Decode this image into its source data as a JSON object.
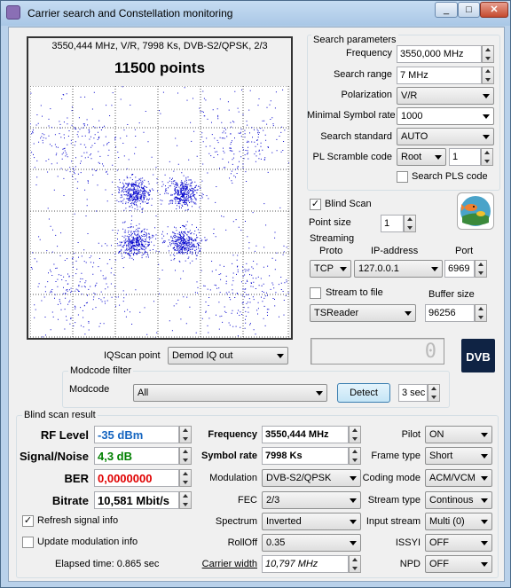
{
  "window": {
    "title": "Carrier search and Constellation monitoring"
  },
  "constellation": {
    "info": "3550,444 MHz, V/R, 7998 Ks, DVB-S2/QPSK, 2/3",
    "points_label": "11500 points"
  },
  "search_params": {
    "legend": "Search parameters",
    "frequency_label": "Frequency",
    "frequency_value": "3550,000 MHz",
    "range_label": "Search range",
    "range_value": "7 MHz",
    "polarization_label": "Polarization",
    "polarization_value": "V/R",
    "msr_label": "Minimal Symbol rate",
    "msr_value": "1000",
    "standard_label": "Search standard",
    "standard_value": "AUTO",
    "pls_label": "PL Scramble code",
    "pls_mode": "Root",
    "pls_value": "1",
    "search_pls_label": "Search PLS code"
  },
  "blind": {
    "blind_scan_label": "Blind Scan",
    "point_size_label": "Point size",
    "point_size_value": "1"
  },
  "streaming": {
    "legend": "Streaming",
    "proto_label": "Proto",
    "proto_value": "TCP",
    "ip_label": "IP-address",
    "ip_value": "127.0.0.1",
    "port_label": "Port",
    "port_value": "6969",
    "stream_file_label": "Stream to file",
    "buffer_label": "Buffer size",
    "reader_value": "TSReader",
    "buffer_value": "96256"
  },
  "iq": {
    "label": "IQScan point",
    "value": "Demod IQ out",
    "counter": "0"
  },
  "modcode": {
    "legend": "Modcode filter",
    "label": "Modcode",
    "value": "All",
    "detect_label": "Detect",
    "interval_value": "3 sec"
  },
  "result": {
    "legend": "Blind scan result",
    "rf_label": "RF Level",
    "rf_value": "-35 dBm",
    "sn_label": "Signal/Noise",
    "sn_value": "4,3 dB",
    "ber_label": "BER",
    "ber_value": "0,0000000",
    "bitrate_label": "Bitrate",
    "bitrate_value": "10,581 Mbit/s",
    "freq_label": "Frequency",
    "freq_value": "3550,444 MHz",
    "sr_label": "Symbol rate",
    "sr_value": "7998 Ks",
    "mod_label": "Modulation",
    "mod_value": "DVB-S2/QPSK",
    "fec_label": "FEC",
    "fec_value": "2/3",
    "spectrum_label": "Spectrum",
    "spectrum_value": "Inverted",
    "rolloff_label": "RollOff",
    "rolloff_value": "0.35",
    "cw_label": "Carrier width",
    "cw_value": "10,797 MHz",
    "pilot_label": "Pilot",
    "pilot_value": "ON",
    "frame_label": "Frame type",
    "frame_value": "Short",
    "coding_label": "Coding mode",
    "coding_value": "ACM/VCM",
    "stream_label": "Stream type",
    "stream_value": "Continous",
    "input_label": "Input stream",
    "input_value": "Multi (0)",
    "issyi_label": "ISSYI",
    "issyi_value": "OFF",
    "npd_label": "NPD",
    "npd_value": "OFF",
    "refresh_label": "Refresh signal info",
    "update_label": "Update modulation info",
    "elapsed": "Elapsed time: 0.865 sec"
  },
  "colors": {
    "accent_blue": "#1565c0",
    "ber_red": "#e00000",
    "sn_green": "#008000",
    "point_blue": "#0000cc"
  },
  "icons": {
    "app": "app-icon",
    "fish": "fish-logo",
    "dvb": "dvb-logo"
  }
}
